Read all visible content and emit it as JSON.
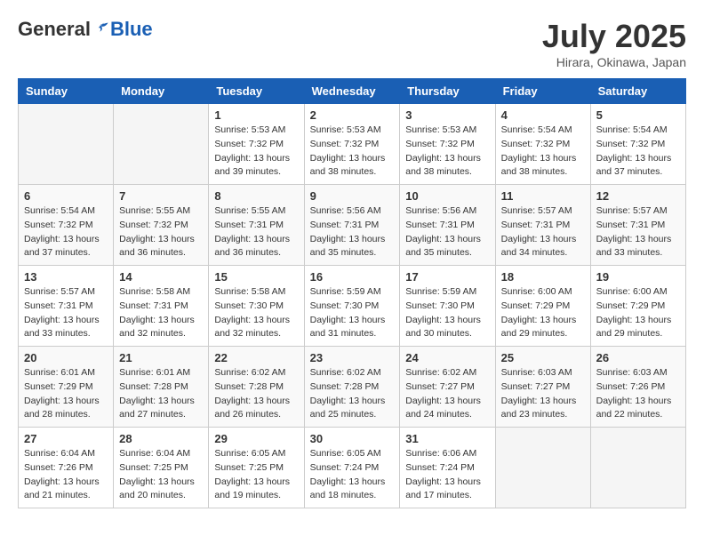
{
  "logo": {
    "general": "General",
    "blue": "Blue"
  },
  "title": "July 2025",
  "location": "Hirara, Okinawa, Japan",
  "weekdays": [
    "Sunday",
    "Monday",
    "Tuesday",
    "Wednesday",
    "Thursday",
    "Friday",
    "Saturday"
  ],
  "weeks": [
    [
      {
        "day": "",
        "info": ""
      },
      {
        "day": "",
        "info": ""
      },
      {
        "day": "1",
        "info": "Sunrise: 5:53 AM\nSunset: 7:32 PM\nDaylight: 13 hours and 39 minutes."
      },
      {
        "day": "2",
        "info": "Sunrise: 5:53 AM\nSunset: 7:32 PM\nDaylight: 13 hours and 38 minutes."
      },
      {
        "day": "3",
        "info": "Sunrise: 5:53 AM\nSunset: 7:32 PM\nDaylight: 13 hours and 38 minutes."
      },
      {
        "day": "4",
        "info": "Sunrise: 5:54 AM\nSunset: 7:32 PM\nDaylight: 13 hours and 38 minutes."
      },
      {
        "day": "5",
        "info": "Sunrise: 5:54 AM\nSunset: 7:32 PM\nDaylight: 13 hours and 37 minutes."
      }
    ],
    [
      {
        "day": "6",
        "info": "Sunrise: 5:54 AM\nSunset: 7:32 PM\nDaylight: 13 hours and 37 minutes."
      },
      {
        "day": "7",
        "info": "Sunrise: 5:55 AM\nSunset: 7:32 PM\nDaylight: 13 hours and 36 minutes."
      },
      {
        "day": "8",
        "info": "Sunrise: 5:55 AM\nSunset: 7:31 PM\nDaylight: 13 hours and 36 minutes."
      },
      {
        "day": "9",
        "info": "Sunrise: 5:56 AM\nSunset: 7:31 PM\nDaylight: 13 hours and 35 minutes."
      },
      {
        "day": "10",
        "info": "Sunrise: 5:56 AM\nSunset: 7:31 PM\nDaylight: 13 hours and 35 minutes."
      },
      {
        "day": "11",
        "info": "Sunrise: 5:57 AM\nSunset: 7:31 PM\nDaylight: 13 hours and 34 minutes."
      },
      {
        "day": "12",
        "info": "Sunrise: 5:57 AM\nSunset: 7:31 PM\nDaylight: 13 hours and 33 minutes."
      }
    ],
    [
      {
        "day": "13",
        "info": "Sunrise: 5:57 AM\nSunset: 7:31 PM\nDaylight: 13 hours and 33 minutes."
      },
      {
        "day": "14",
        "info": "Sunrise: 5:58 AM\nSunset: 7:31 PM\nDaylight: 13 hours and 32 minutes."
      },
      {
        "day": "15",
        "info": "Sunrise: 5:58 AM\nSunset: 7:30 PM\nDaylight: 13 hours and 32 minutes."
      },
      {
        "day": "16",
        "info": "Sunrise: 5:59 AM\nSunset: 7:30 PM\nDaylight: 13 hours and 31 minutes."
      },
      {
        "day": "17",
        "info": "Sunrise: 5:59 AM\nSunset: 7:30 PM\nDaylight: 13 hours and 30 minutes."
      },
      {
        "day": "18",
        "info": "Sunrise: 6:00 AM\nSunset: 7:29 PM\nDaylight: 13 hours and 29 minutes."
      },
      {
        "day": "19",
        "info": "Sunrise: 6:00 AM\nSunset: 7:29 PM\nDaylight: 13 hours and 29 minutes."
      }
    ],
    [
      {
        "day": "20",
        "info": "Sunrise: 6:01 AM\nSunset: 7:29 PM\nDaylight: 13 hours and 28 minutes."
      },
      {
        "day": "21",
        "info": "Sunrise: 6:01 AM\nSunset: 7:28 PM\nDaylight: 13 hours and 27 minutes."
      },
      {
        "day": "22",
        "info": "Sunrise: 6:02 AM\nSunset: 7:28 PM\nDaylight: 13 hours and 26 minutes."
      },
      {
        "day": "23",
        "info": "Sunrise: 6:02 AM\nSunset: 7:28 PM\nDaylight: 13 hours and 25 minutes."
      },
      {
        "day": "24",
        "info": "Sunrise: 6:02 AM\nSunset: 7:27 PM\nDaylight: 13 hours and 24 minutes."
      },
      {
        "day": "25",
        "info": "Sunrise: 6:03 AM\nSunset: 7:27 PM\nDaylight: 13 hours and 23 minutes."
      },
      {
        "day": "26",
        "info": "Sunrise: 6:03 AM\nSunset: 7:26 PM\nDaylight: 13 hours and 22 minutes."
      }
    ],
    [
      {
        "day": "27",
        "info": "Sunrise: 6:04 AM\nSunset: 7:26 PM\nDaylight: 13 hours and 21 minutes."
      },
      {
        "day": "28",
        "info": "Sunrise: 6:04 AM\nSunset: 7:25 PM\nDaylight: 13 hours and 20 minutes."
      },
      {
        "day": "29",
        "info": "Sunrise: 6:05 AM\nSunset: 7:25 PM\nDaylight: 13 hours and 19 minutes."
      },
      {
        "day": "30",
        "info": "Sunrise: 6:05 AM\nSunset: 7:24 PM\nDaylight: 13 hours and 18 minutes."
      },
      {
        "day": "31",
        "info": "Sunrise: 6:06 AM\nSunset: 7:24 PM\nDaylight: 13 hours and 17 minutes."
      },
      {
        "day": "",
        "info": ""
      },
      {
        "day": "",
        "info": ""
      }
    ]
  ]
}
